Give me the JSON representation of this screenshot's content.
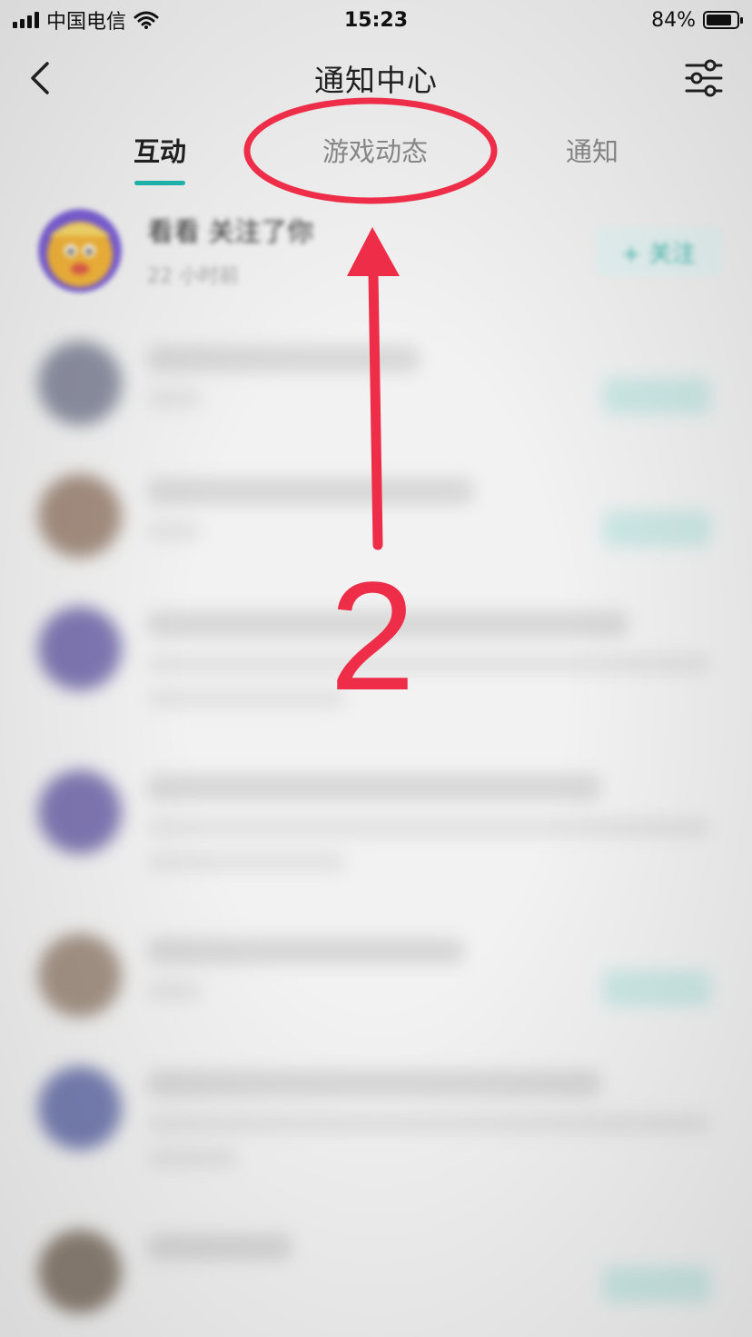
{
  "status_bar": {
    "carrier": "中国电信",
    "time": "15:23",
    "battery_percent": "84%",
    "battery_level": 0.84
  },
  "header": {
    "title": "通知中心",
    "back_icon": "chevron-left-icon",
    "filter_icon": "sliders-icon"
  },
  "tabs": [
    {
      "label": "互动",
      "active": true
    },
    {
      "label": "游戏动态",
      "active": false
    },
    {
      "label": "通知",
      "active": false
    }
  ],
  "notifications": [
    {
      "title": "看看 关注了你",
      "time": "22 小时前",
      "action": "+ 关注",
      "blurred": false
    }
  ],
  "annotation": {
    "step_label": "2",
    "color": "#ee2d49"
  },
  "colors": {
    "accent": "#20b8b0",
    "annotation": "#ee2d49"
  }
}
